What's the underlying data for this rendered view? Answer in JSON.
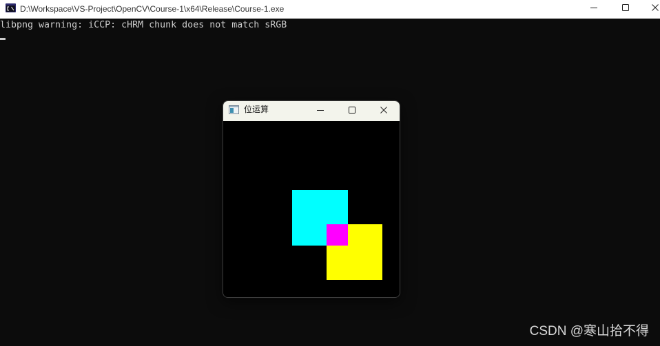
{
  "console_window": {
    "title": "D:\\Workspace\\VS-Project\\OpenCV\\Course-1\\x64\\Release\\Course-1.exe",
    "app_icon": "console-app-icon",
    "controls": {
      "minimize": "minimize-icon",
      "maximize": "maximize-icon",
      "close": "close-icon"
    },
    "output_lines": [
      "libpng warning: iCCP: cHRM chunk does not match sRGB"
    ]
  },
  "opencv_window": {
    "title": "位运算",
    "app_icon": "image-window-icon",
    "controls": {
      "minimize": "minimize-icon",
      "maximize": "maximize-icon",
      "close": "close-icon"
    },
    "canvas": {
      "colors": {
        "background": "#000000",
        "square_a": "#00ffff",
        "square_b": "#ffff00",
        "overlap": "#ff00ff"
      }
    }
  },
  "watermark": {
    "text": "CSDN @寒山拾不得"
  }
}
